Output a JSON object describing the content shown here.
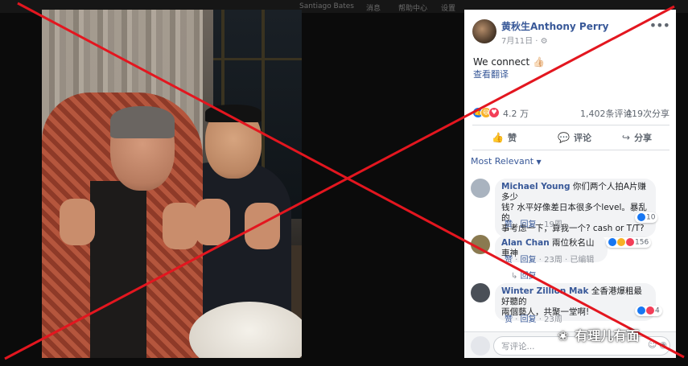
{
  "top_bar": {
    "blurred_items": [
      "Santiago Bates",
      "消息",
      "帮助中心",
      "设置"
    ]
  },
  "post": {
    "author": "黄秋生Anthony Perry",
    "date": "7月11日",
    "privacy_icon": "globe-icon",
    "text": "We connect 👍🏻",
    "translate_link": "查看翻译",
    "reaction_count": "4.2 万",
    "comment_count": "1,402条评论",
    "share_count": "419次分享",
    "actions": {
      "like": "赞",
      "comment": "评论",
      "share": "分享"
    }
  },
  "comments_sort": "Most Relevant",
  "comments": [
    {
      "name": "Michael Young",
      "text_line1": "你们两个人拍A片赚多少",
      "text_line2": "钱? 水平好像差日本很多个level。暴乱的",
      "text_line3": "事考虑一下，算我一个? cash or T/T?",
      "reactions": "10",
      "like": "赞",
      "reply": "回复",
      "time": "19周"
    },
    {
      "name": "Alan Chan",
      "text_line1": "兩位秋名山車神",
      "reactions": "156",
      "like": "赞",
      "reply": "回复",
      "time": "23周",
      "edited": "已编辑",
      "reply_link": "回复"
    },
    {
      "name": "Winter Zillion Mak",
      "text_line1": "全香港爆粗最好聽的",
      "text_line2": "兩個藝人，共聚一堂啊!",
      "reactions": "4",
      "like": "赞",
      "reply": "回复",
      "time": "23周"
    }
  ],
  "composer": {
    "placeholder": "写评论..."
  },
  "watermark": "有理儿有面",
  "colors": {
    "facebook_link": "#385898",
    "cross_line": "#e3161f",
    "background": "#0b0b0b"
  }
}
